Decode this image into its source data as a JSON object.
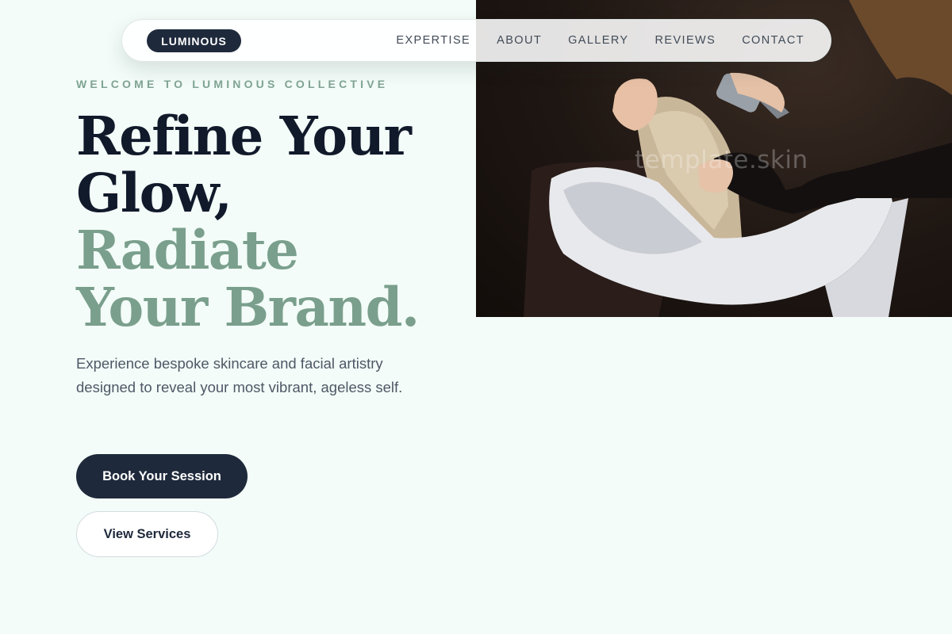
{
  "nav": {
    "brand": "LUMINOUS",
    "links": [
      "EXPERTISE",
      "ABOUT",
      "GALLERY",
      "REVIEWS",
      "CONTACT"
    ]
  },
  "hero": {
    "eyebrow": "WELCOME TO LUMINOUS COLLECTIVE",
    "headline_line1": "Refine Your",
    "headline_line2": "Glow,",
    "headline_line3": "Radiate",
    "headline_line4": "Your Brand.",
    "subtext": "Experience bespoke skincare and facial artistry designed to reveal your most vibrant, ageless self.",
    "primary_cta": "Book Your Session",
    "secondary_cta": "View Services"
  },
  "photo": {
    "watermark": "template.skin"
  },
  "colors": {
    "background": "#f3fcf8",
    "navy": "#1e293b",
    "sage": "#7a9f8d",
    "heading_dark": "#111a2b"
  }
}
